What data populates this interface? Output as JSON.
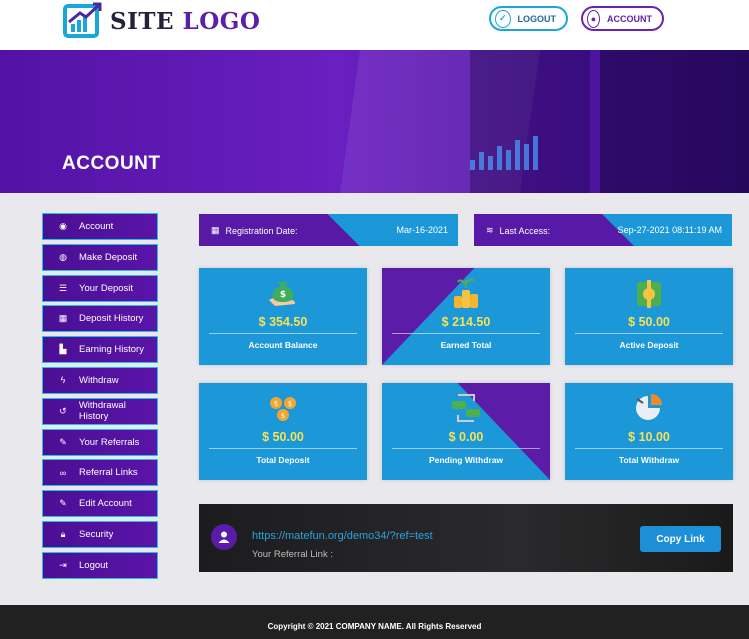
{
  "header": {
    "logo_text_1": "SITE",
    "logo_text_2": "LOGO",
    "logout_label": "LOGOUT",
    "account_label": "ACCOUNT"
  },
  "banner": {
    "title": "ACCOUNT"
  },
  "sidebar": {
    "items": [
      {
        "label": "Account",
        "icon": "user-circle-icon"
      },
      {
        "label": "Make Deposit",
        "icon": "coin-icon"
      },
      {
        "label": "Your Deposit",
        "icon": "list-icon"
      },
      {
        "label": "Deposit History",
        "icon": "calendar-icon"
      },
      {
        "label": "Earning History",
        "icon": "chart-icon"
      },
      {
        "label": "Withdraw",
        "icon": "bolt-icon"
      },
      {
        "label": "Withdrawal History",
        "icon": "history-icon"
      },
      {
        "label": "Your Referrals",
        "icon": "edit-icon"
      },
      {
        "label": "Referral Links",
        "icon": "link-icon"
      },
      {
        "label": "Edit Account",
        "icon": "edit-icon"
      },
      {
        "label": "Security",
        "icon": "lock-icon"
      },
      {
        "label": "Logout",
        "icon": "sign-out-icon"
      }
    ]
  },
  "info": {
    "registration_label": "Registration Date:",
    "registration_value": "Mar-16-2021",
    "last_access_label": "Last Access:",
    "last_access_value": "Sep-27-2021 08:11:19 AM"
  },
  "stats": [
    {
      "amount": "$ 354.50",
      "label": "Account Balance",
      "icon": "money-bag-icon"
    },
    {
      "amount": "$ 214.50",
      "label": "Earned Total",
      "icon": "coin-stack-icon"
    },
    {
      "amount": "$ 50.00",
      "label": "Active Deposit",
      "icon": "cash-icon"
    },
    {
      "amount": "$ 50.00",
      "label": "Total Deposit",
      "icon": "coins-icon"
    },
    {
      "amount": "$ 0.00",
      "label": "Pending Withdraw",
      "icon": "exchange-icon"
    },
    {
      "amount": "$ 10.00",
      "label": "Total Withdraw",
      "icon": "pie-chart-icon"
    }
  ],
  "referral": {
    "url": "https://matefun.org/demo34/?ref=test",
    "label": "Your Referral Link :",
    "copy_label": "Copy Link"
  },
  "footer": {
    "copyright": "Copyright © 2021 COMPANY NAME. All Rights Reserved"
  },
  "colors": {
    "purple": "#5b1ca8",
    "blue": "#1c98d8",
    "gold": "#f3e25a"
  }
}
